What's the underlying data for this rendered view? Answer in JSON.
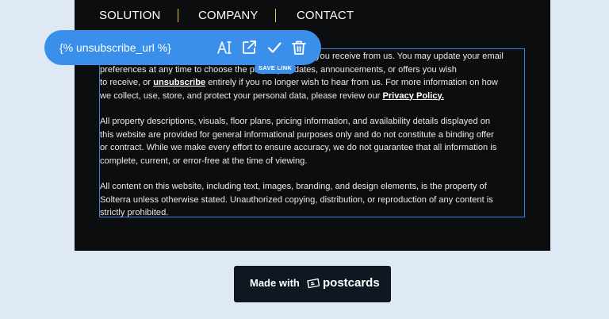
{
  "nav": {
    "items": [
      "SOLUTION",
      "COMPANY",
      "CONTACT"
    ]
  },
  "editor_toolbar": {
    "merge_tag": "{% unsubscribe_url %}",
    "tooltip": "SAVE LINK",
    "icons": [
      "text-format-icon",
      "open-link-icon",
      "check-icon",
      "trash-icon"
    ]
  },
  "footer_text": {
    "p1": {
      "line1": "you receive from us.  You may update your email",
      "line2a": "preferences at any time to choose the ",
      "line2b": "property updates, announcements, or offers you wish",
      "line3a": "to receive, or ",
      "line3_link": "unsubscribe",
      "line3b": " entirely if you no longer wish to hear from us.  For more information on how",
      "line4a": "we collect, use, store, and protect your personal data, please review our ",
      "line4_link": "Privacy Policy."
    },
    "p2": {
      "line1": "All property descriptions, visuals, floor plans, pricing information, and availability details displayed on",
      "line2": "this website are provided for general informational purposes only and do not constitute a binding offer",
      "line3": "or contract. While we make every effort to ensure accuracy, we do not guarantee that all information is",
      "line4": "complete, current, or error-free at the time of viewing."
    },
    "p3": {
      "line1": "All content on this website, including text, images, branding, and design elements, is the property of",
      "line2": "Solterra unless otherwise stated.  Unauthorized copying, distribution, or reproduction of any content is",
      "line3": "strictly prohibited."
    }
  },
  "badge": {
    "label": "Made with",
    "brand": "postcards"
  },
  "colors": {
    "page_bg": "#dfe9f6",
    "email_bg": "#0c0d0f",
    "accent": "#3a8fea",
    "separator": "#e9c63a"
  }
}
